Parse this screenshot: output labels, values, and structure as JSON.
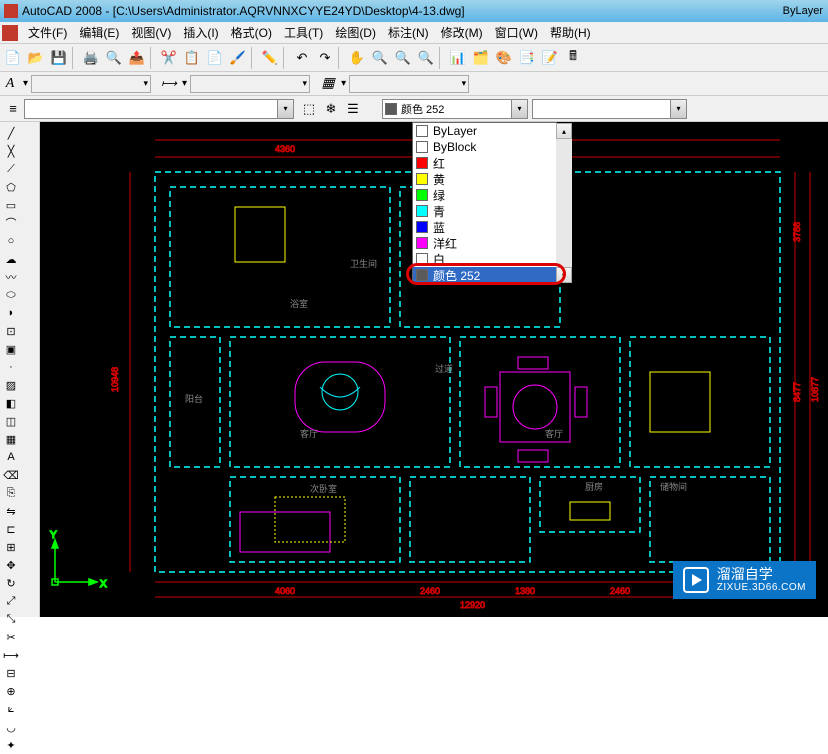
{
  "titlebar": {
    "app": "AutoCAD 2008",
    "file": "[C:\\Users\\Administrator.AQRVNNXCYYE24YD\\Desktop\\4-13.dwg]"
  },
  "menu": {
    "items": [
      "文件(F)",
      "编辑(E)",
      "视图(V)",
      "插入(I)",
      "格式(O)",
      "工具(T)",
      "绘图(D)",
      "标注(N)",
      "修改(M)",
      "窗口(W)",
      "帮助(H)"
    ]
  },
  "proprow": {
    "color_label": "颜色 252",
    "bylayer": "ByLayer"
  },
  "colordrop": {
    "items": [
      {
        "label": "ByLayer",
        "color": "#fff",
        "border": true
      },
      {
        "label": "ByBlock",
        "color": "#fff",
        "border": true
      },
      {
        "label": "红",
        "color": "#ff0000"
      },
      {
        "label": "黄",
        "color": "#ffff00"
      },
      {
        "label": "绿",
        "color": "#00ff00"
      },
      {
        "label": "青",
        "color": "#00ffff"
      },
      {
        "label": "蓝",
        "color": "#0000ff"
      },
      {
        "label": "洋红",
        "color": "#ff00ff"
      },
      {
        "label": "白",
        "color": "#ffffff",
        "border": true
      },
      {
        "label": "颜色 252",
        "color": "#5a5a5a",
        "selected": true
      }
    ]
  },
  "canvas": {
    "dims": [
      "4360",
      "4060",
      "2460",
      "1380",
      "2460",
      "12920",
      "10948",
      "3788",
      "8477",
      "10877"
    ],
    "rooms": [
      "卫生间",
      "浴室",
      "阳台",
      "客厅",
      "过道",
      "客厅",
      "厨房",
      "储物间",
      "次卧室"
    ]
  },
  "watermark": {
    "title": "溜溜自学",
    "url": "ZIXUE.3D66.COM"
  }
}
